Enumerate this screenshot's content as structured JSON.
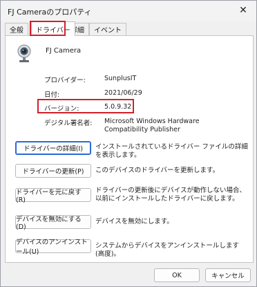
{
  "window": {
    "title": "FJ Cameraのプロパティ",
    "close_glyph": "✕"
  },
  "tabs": [
    {
      "label": "全般"
    },
    {
      "label": "ドライバー"
    },
    {
      "label": "詳細"
    },
    {
      "label": "イベント"
    }
  ],
  "active_tab": "ドライバー",
  "device": {
    "icon": "webcam-icon",
    "name": "FJ Camera"
  },
  "properties": {
    "provider_label": "プロバイダー:",
    "provider_value": "SunplusIT",
    "date_label": "日付:",
    "date_value": "2021/06/29",
    "version_label": "バージョン:",
    "version_value": "5.0.9.32",
    "signer_label": "デジタル署名者:",
    "signer_value": "Microsoft Windows Hardware Compatibility Publisher"
  },
  "actions": [
    {
      "label": "ドライバーの詳細(I)",
      "desc": "インストールされているドライバー ファイルの詳細を表示します。"
    },
    {
      "label": "ドライバーの更新(P)",
      "desc": "このデバイスのドライバーを更新します。"
    },
    {
      "label": "ドライバーを元に戻す(R)",
      "desc": "ドライバーの更新後にデバイスが動作しない場合、以前にインストールしたドライバーに戻します。"
    },
    {
      "label": "デバイスを無効にする(D)",
      "desc": "デバイスを無効にします。"
    },
    {
      "label": "デバイスのアンインストール(U)",
      "desc": "システムからデバイスをアンインストールします (高度)。"
    }
  ],
  "footer": {
    "ok_label": "OK",
    "cancel_label": "キャンセル"
  },
  "colors": {
    "highlight": "#d21f2b",
    "focus": "#2a6ad6"
  }
}
